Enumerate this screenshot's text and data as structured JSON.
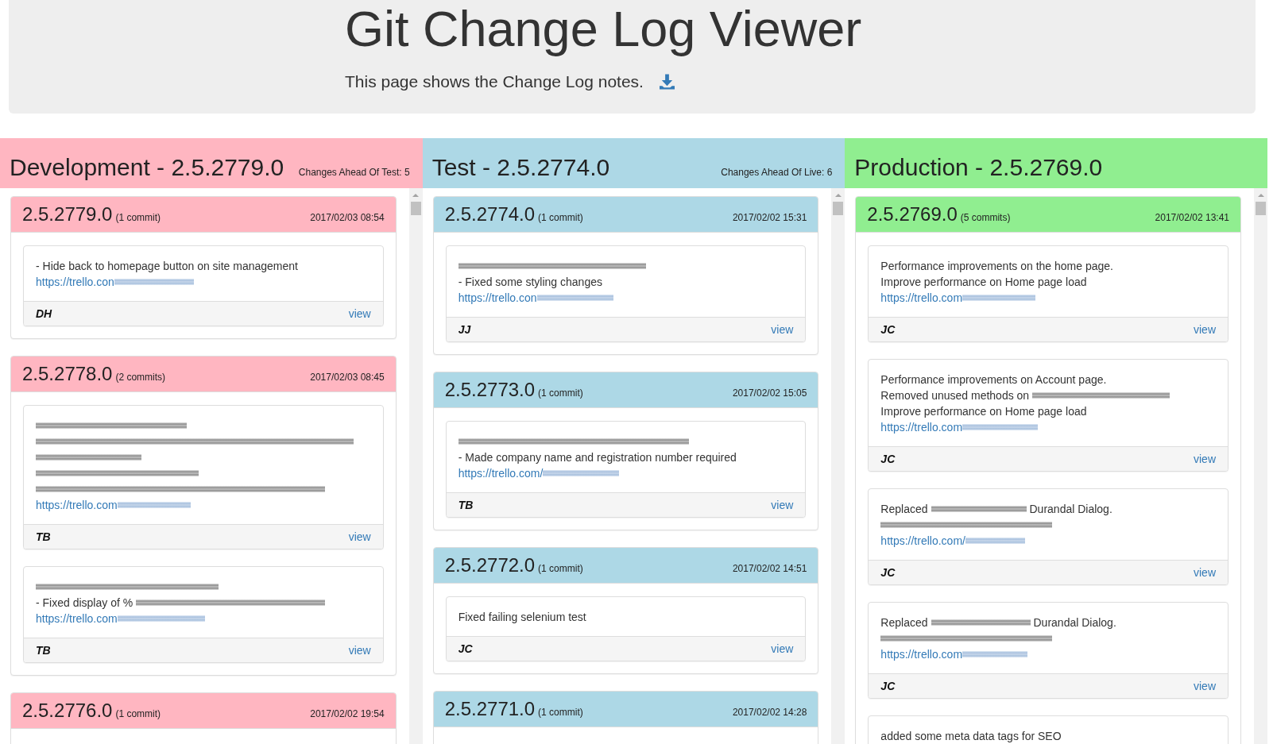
{
  "header": {
    "title": "Git Change Log Viewer",
    "subtitle": "This page shows the Change Log notes."
  },
  "columns": [
    {
      "title": "Development - 2.5.2779.0",
      "note": "Changes Ahead Of Test: 5",
      "color": "#ffb6c1",
      "releases": [
        {
          "version": "2.5.2779.0",
          "count": "(1 commit)",
          "date": "2017/02/03 08:54",
          "commits": [
            {
              "lines": [
                [
                  {
                    "kind": "text",
                    "text": "- Hide back to homepage button on site management"
                  }
                ],
                [
                  {
                    "kind": "link",
                    "text": "https://trello.con"
                  },
                  {
                    "kind": "redacted_link"
                  }
                ]
              ],
              "author": "DH",
              "action": "view"
            }
          ]
        },
        {
          "version": "2.5.2778.0",
          "count": "(2 commits)",
          "date": "2017/02/03 08:45",
          "commits": [
            {
              "lines": [
                [
                  {
                    "kind": "redacted"
                  }
                ],
                [
                  {
                    "kind": "redacted"
                  }
                ],
                [
                  {
                    "kind": "redacted"
                  }
                ],
                [
                  {
                    "kind": "redacted"
                  }
                ],
                [
                  {
                    "kind": "redacted"
                  }
                ],
                [
                  {
                    "kind": "link",
                    "text": "https://trello.com"
                  },
                  {
                    "kind": "redacted_link"
                  }
                ]
              ],
              "author": "TB",
              "action": "view"
            },
            {
              "lines": [
                [
                  {
                    "kind": "redacted"
                  }
                ],
                [
                  {
                    "kind": "text",
                    "text": "- Fixed display of %"
                  },
                  {
                    "kind": "redacted"
                  }
                ],
                [
                  {
                    "kind": "link",
                    "text": "https://trello.com"
                  },
                  {
                    "kind": "redacted_link"
                  }
                ]
              ],
              "author": "TB",
              "action": "view"
            }
          ]
        },
        {
          "version": "2.5.2776.0",
          "count": "(1 commit)",
          "date": "2017/02/02 19:54"
        }
      ]
    },
    {
      "title": "Test - 2.5.2774.0",
      "note": "Changes Ahead Of Live: 6",
      "color": "#add8e6",
      "releases": [
        {
          "version": "2.5.2774.0",
          "count": "(1 commit)",
          "date": "2017/02/02 15:31",
          "commits": [
            {
              "lines": [
                [
                  {
                    "kind": "redacted"
                  }
                ],
                [
                  {
                    "kind": "text",
                    "text": "- Fixed some styling changes"
                  }
                ],
                [
                  {
                    "kind": "link",
                    "text": "https://trello.con"
                  },
                  {
                    "kind": "redacted_link"
                  }
                ]
              ],
              "author": "JJ",
              "action": "view"
            }
          ]
        },
        {
          "version": "2.5.2773.0",
          "count": "(1 commit)",
          "date": "2017/02/02 15:05",
          "commits": [
            {
              "lines": [
                [
                  {
                    "kind": "redacted"
                  }
                ],
                [
                  {
                    "kind": "text",
                    "text": "- Made company name and registration number required"
                  }
                ],
                [
                  {
                    "kind": "link",
                    "text": "https://trello.com/"
                  },
                  {
                    "kind": "redacted_link"
                  }
                ]
              ],
              "author": "TB",
              "action": "view"
            }
          ]
        },
        {
          "version": "2.5.2772.0",
          "count": "(1 commit)",
          "date": "2017/02/02 14:51",
          "commits": [
            {
              "lines": [
                [
                  {
                    "kind": "text",
                    "text": "Fixed failing selenium test"
                  }
                ]
              ],
              "author": "JC",
              "action": "view"
            }
          ]
        },
        {
          "version": "2.5.2771.0",
          "count": "(1 commit)",
          "date": "2017/02/02 14:28"
        }
      ]
    },
    {
      "title": "Production - 2.5.2769.0",
      "color": "#90ee90",
      "releases": [
        {
          "version": "2.5.2769.0",
          "count": "(5 commits)",
          "date": "2017/02/02 13:41",
          "commits": [
            {
              "lines": [
                [
                  {
                    "kind": "text",
                    "text": "Performance improvements on the home page."
                  }
                ],
                [
                  {
                    "kind": "text",
                    "text": "Improve performance on Home page load"
                  }
                ],
                [
                  {
                    "kind": "link",
                    "text": "https://trello.com"
                  },
                  {
                    "kind": "redacted_link"
                  }
                ]
              ],
              "author": "JC",
              "action": "view"
            },
            {
              "lines": [
                [
                  {
                    "kind": "text",
                    "text": "Performance improvements on Account page."
                  }
                ],
                [
                  {
                    "kind": "text",
                    "text": "Removed unused methods on"
                  },
                  {
                    "kind": "redacted"
                  }
                ],
                [
                  {
                    "kind": "text",
                    "text": "Improve performance on Home page load"
                  }
                ],
                [
                  {
                    "kind": "link",
                    "text": "https://trello.com"
                  },
                  {
                    "kind": "redacted_link"
                  }
                ]
              ],
              "author": "JC",
              "action": "view"
            },
            {
              "lines": [
                [
                  {
                    "kind": "text",
                    "text": "Replaced"
                  },
                  {
                    "kind": "redacted"
                  },
                  {
                    "kind": "text",
                    "text": "Durandal Dialog."
                  }
                ],
                [
                  {
                    "kind": "redacted"
                  }
                ],
                [
                  {
                    "kind": "link",
                    "text": "https://trello.com/"
                  },
                  {
                    "kind": "redacted_link"
                  }
                ]
              ],
              "author": "JC",
              "action": "view"
            },
            {
              "lines": [
                [
                  {
                    "kind": "text",
                    "text": "Replaced"
                  },
                  {
                    "kind": "redacted"
                  },
                  {
                    "kind": "text",
                    "text": "Durandal Dialog."
                  }
                ],
                [
                  {
                    "kind": "redacted"
                  }
                ],
                [
                  {
                    "kind": "link",
                    "text": "https://trello.com"
                  },
                  {
                    "kind": "redacted_link"
                  }
                ]
              ],
              "author": "JC",
              "action": "view"
            },
            {
              "lines": [
                [
                  {
                    "kind": "text",
                    "text": "added some meta data tags for SEO"
                  }
                ]
              ]
            }
          ]
        }
      ]
    }
  ]
}
